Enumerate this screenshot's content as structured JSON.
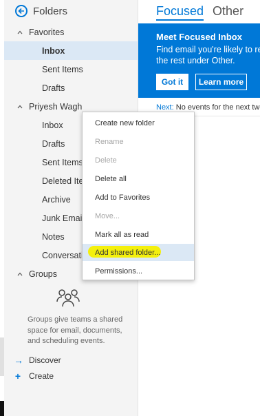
{
  "sidebar": {
    "title": "Folders",
    "favorites": {
      "label": "Favorites",
      "items": [
        {
          "label": "Inbox"
        },
        {
          "label": "Sent Items"
        },
        {
          "label": "Drafts"
        }
      ]
    },
    "account": {
      "label": "Priyesh Wagh",
      "items": [
        {
          "label": "Inbox"
        },
        {
          "label": "Drafts"
        },
        {
          "label": "Sent Items"
        },
        {
          "label": "Deleted Items"
        },
        {
          "label": "Archive"
        },
        {
          "label": "Junk Email"
        },
        {
          "label": "Notes"
        },
        {
          "label": "Conversation History"
        }
      ]
    },
    "groups": {
      "label": "Groups",
      "description": "Groups give teams a shared space for email, documents, and scheduling events.",
      "discover": "Discover",
      "create": "Create"
    }
  },
  "main": {
    "tabs": [
      {
        "label": "Focused",
        "active": true
      },
      {
        "label": "Other",
        "active": false
      }
    ],
    "banner": {
      "title": "Meet Focused Inbox",
      "line1": "Find email you're likely to read",
      "line2": "the rest under Other.",
      "got_it": "Got it",
      "learn_more": "Learn more"
    },
    "next": {
      "label": "Next:",
      "text": "No events for the next two days."
    }
  },
  "context_menu": {
    "items": [
      {
        "label": "Create new folder",
        "disabled": false
      },
      {
        "label": "Rename",
        "disabled": true
      },
      {
        "label": "Delete",
        "disabled": true
      },
      {
        "label": "Delete all",
        "disabled": false
      },
      {
        "label": "Add to Favorites",
        "disabled": false
      },
      {
        "label": "Move...",
        "disabled": true
      },
      {
        "label": "Mark all as read",
        "disabled": false
      },
      {
        "label": "Add shared folder...",
        "disabled": false,
        "highlighted": true
      },
      {
        "label": "Permissions...",
        "disabled": false
      }
    ]
  },
  "colors": {
    "accent": "#0078d7",
    "sidebar_bg": "#f4f4f4",
    "selected_bg": "#dbe8f5",
    "highlighter": "#f5f000"
  }
}
